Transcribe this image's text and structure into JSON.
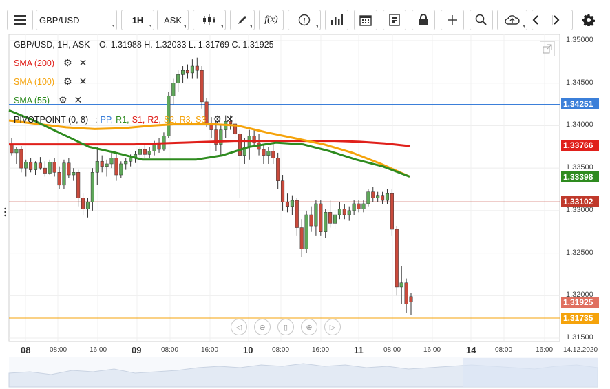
{
  "toolbar": {
    "symbol": "GBP/USD",
    "timeframe": "1H",
    "price_type": "ASK"
  },
  "legend": {
    "symbol_info": "GBP/USD, 1H, ASK",
    "ohlc": "O. 1.31988 H. 1.32033 L. 1.31769 C. 1.31925"
  },
  "indicators": [
    {
      "label": "SMA (200)",
      "color": "#e0201b"
    },
    {
      "label": "SMA (100)",
      "color": "#f5a30b"
    },
    {
      "label": "SMA (55)",
      "color": "#2e8b1f"
    }
  ],
  "pivot": {
    "label": "PIVOTPOINT (0, 8)",
    "separator": ":",
    "parts": [
      {
        "text": "PP,",
        "color": "#3b7fd9"
      },
      {
        "text": "R1,",
        "color": "#2e8b1f"
      },
      {
        "text": "S1,",
        "color": "#e0201b"
      },
      {
        "text": "R2,",
        "color": "#e0201b"
      },
      {
        "text": "S2,",
        "color": "#f5a30b"
      },
      {
        "text": "R3,",
        "color": "#f5a30b"
      },
      {
        "text": "S3",
        "color": "#f5a30b"
      }
    ]
  },
  "price_axis": [
    "1.35000",
    "1.34500",
    "1.34000",
    "1.33500",
    "1.33000",
    "1.32500",
    "1.32000",
    "1.31500"
  ],
  "price_tags": [
    {
      "value": "1.34251",
      "color": "#3b7fd9"
    },
    {
      "value": "1.33766",
      "color": "#e0201b"
    },
    {
      "value": "1.33398",
      "color": "#2e8b1f"
    },
    {
      "value": "1.33102",
      "color": "#c0392b"
    },
    {
      "value": "1.31925",
      "color": "#e07060"
    },
    {
      "value": "1.31735",
      "color": "#f5a30b"
    }
  ],
  "time_axis": [
    {
      "label": "08",
      "day": true
    },
    {
      "label": "08:00",
      "day": false
    },
    {
      "label": "16:00",
      "day": false
    },
    {
      "label": "09",
      "day": true
    },
    {
      "label": "08:00",
      "day": false
    },
    {
      "label": "16:00",
      "day": false
    },
    {
      "label": "10",
      "day": true
    },
    {
      "label": "08:00",
      "day": false
    },
    {
      "label": "16:00",
      "day": false
    },
    {
      "label": "11",
      "day": true
    },
    {
      "label": "08:00",
      "day": false
    },
    {
      "label": "16:00",
      "day": false
    },
    {
      "label": "14",
      "day": true
    },
    {
      "label": "08:00",
      "day": false
    },
    {
      "label": "16:00",
      "day": false
    },
    {
      "label": "14.12.2020",
      "day": false
    }
  ],
  "chart_data": {
    "type": "candlestick",
    "symbol": "GBP/USD",
    "interval": "1H",
    "ylim": [
      1.3135,
      1.351
    ],
    "levels": {
      "pivot_pp": 1.34251,
      "s1": 1.33102,
      "s2": 1.31735,
      "last": 1.31925
    },
    "candles": [
      [
        1.3378,
        1.3385,
        1.3365,
        1.3368
      ],
      [
        1.3368,
        1.3375,
        1.3355,
        1.3372
      ],
      [
        1.3372,
        1.3376,
        1.3345,
        1.335
      ],
      [
        1.335,
        1.336,
        1.334,
        1.3357
      ],
      [
        1.3357,
        1.3362,
        1.3345,
        1.3348
      ],
      [
        1.3348,
        1.3358,
        1.3342,
        1.3356
      ],
      [
        1.3356,
        1.3363,
        1.3348,
        1.335
      ],
      [
        1.335,
        1.3358,
        1.334,
        1.3344
      ],
      [
        1.3344,
        1.336,
        1.3342,
        1.3357
      ],
      [
        1.3357,
        1.3362,
        1.334,
        1.3345
      ],
      [
        1.3345,
        1.3352,
        1.3325,
        1.333
      ],
      [
        1.333,
        1.336,
        1.3325,
        1.3356
      ],
      [
        1.3356,
        1.3362,
        1.3338,
        1.3342
      ],
      [
        1.3342,
        1.335,
        1.3335,
        1.3345
      ],
      [
        1.3345,
        1.3348,
        1.3305,
        1.3315
      ],
      [
        1.3315,
        1.332,
        1.3295,
        1.3302
      ],
      [
        1.3302,
        1.3315,
        1.3292,
        1.331
      ],
      [
        1.331,
        1.335,
        1.33,
        1.3345
      ],
      [
        1.3345,
        1.3375,
        1.333,
        1.3358
      ],
      [
        1.3358,
        1.3365,
        1.3345,
        1.3352
      ],
      [
        1.3352,
        1.336,
        1.334,
        1.3355
      ],
      [
        1.3355,
        1.3368,
        1.335,
        1.3362
      ],
      [
        1.3362,
        1.3368,
        1.3335,
        1.3342
      ],
      [
        1.3342,
        1.3358,
        1.3338,
        1.3355
      ],
      [
        1.3355,
        1.3362,
        1.3348,
        1.3358
      ],
      [
        1.3358,
        1.3366,
        1.3352,
        1.3362
      ],
      [
        1.3362,
        1.337,
        1.3356,
        1.3366
      ],
      [
        1.3366,
        1.3375,
        1.336,
        1.3372
      ],
      [
        1.3372,
        1.3378,
        1.3362,
        1.3366
      ],
      [
        1.3366,
        1.3375,
        1.3362,
        1.337
      ],
      [
        1.337,
        1.3382,
        1.3365,
        1.3378
      ],
      [
        1.3378,
        1.3385,
        1.3368,
        1.3372
      ],
      [
        1.3372,
        1.3392,
        1.337,
        1.3388
      ],
      [
        1.3388,
        1.344,
        1.3385,
        1.3435
      ],
      [
        1.3435,
        1.3455,
        1.3425,
        1.345
      ],
      [
        1.345,
        1.3465,
        1.344,
        1.346
      ],
      [
        1.346,
        1.347,
        1.345,
        1.3465
      ],
      [
        1.3465,
        1.3472,
        1.3455,
        1.3462
      ],
      [
        1.3462,
        1.3478,
        1.3455,
        1.347
      ],
      [
        1.347,
        1.348,
        1.3455,
        1.3465
      ],
      [
        1.3465,
        1.347,
        1.342,
        1.3428
      ],
      [
        1.3428,
        1.3432,
        1.3398,
        1.3403
      ],
      [
        1.3403,
        1.341,
        1.3385,
        1.3395
      ],
      [
        1.3395,
        1.3405,
        1.337,
        1.3378
      ],
      [
        1.3378,
        1.34,
        1.3365,
        1.3395
      ],
      [
        1.3395,
        1.3412,
        1.3385,
        1.3405
      ],
      [
        1.3405,
        1.3412,
        1.3395,
        1.3402
      ],
      [
        1.3402,
        1.341,
        1.3385,
        1.339
      ],
      [
        1.339,
        1.3395,
        1.3315,
        1.3365
      ],
      [
        1.3365,
        1.3385,
        1.3355,
        1.3375
      ],
      [
        1.3375,
        1.3395,
        1.336,
        1.3388
      ],
      [
        1.3388,
        1.3395,
        1.3375,
        1.338
      ],
      [
        1.338,
        1.339,
        1.3365,
        1.3372
      ],
      [
        1.3372,
        1.3378,
        1.3355,
        1.3365
      ],
      [
        1.3365,
        1.3375,
        1.3355,
        1.337
      ],
      [
        1.337,
        1.338,
        1.3355,
        1.3362
      ],
      [
        1.3362,
        1.3368,
        1.3325,
        1.3335
      ],
      [
        1.3335,
        1.3342,
        1.33,
        1.331
      ],
      [
        1.331,
        1.332,
        1.3298,
        1.3305
      ],
      [
        1.3305,
        1.3318,
        1.3295,
        1.3312
      ],
      [
        1.3312,
        1.3315,
        1.327,
        1.328
      ],
      [
        1.328,
        1.329,
        1.3245,
        1.3255
      ],
      [
        1.3255,
        1.33,
        1.325,
        1.3295
      ],
      [
        1.3295,
        1.3305,
        1.3275,
        1.3282
      ],
      [
        1.3282,
        1.3312,
        1.327,
        1.3308
      ],
      [
        1.3308,
        1.3312,
        1.327,
        1.3275
      ],
      [
        1.3275,
        1.3302,
        1.3268,
        1.3298
      ],
      [
        1.3298,
        1.3312,
        1.328,
        1.3285
      ],
      [
        1.3285,
        1.33,
        1.3278,
        1.3295
      ],
      [
        1.3295,
        1.331,
        1.329,
        1.3302
      ],
      [
        1.3302,
        1.3308,
        1.329,
        1.3295
      ],
      [
        1.3295,
        1.3305,
        1.3288,
        1.33
      ],
      [
        1.33,
        1.3312,
        1.3295,
        1.3308
      ],
      [
        1.3308,
        1.3312,
        1.3298,
        1.3302
      ],
      [
        1.3302,
        1.3312,
        1.3298,
        1.3308
      ],
      [
        1.3308,
        1.3325,
        1.3305,
        1.3322
      ],
      [
        1.3322,
        1.3328,
        1.331,
        1.3315
      ],
      [
        1.3315,
        1.3322,
        1.331,
        1.3318
      ],
      [
        1.3318,
        1.3322,
        1.3308,
        1.3312
      ],
      [
        1.3312,
        1.3325,
        1.3308,
        1.332
      ],
      [
        1.332,
        1.3325,
        1.327,
        1.3278
      ],
      [
        1.3278,
        1.3282,
        1.32,
        1.321
      ],
      [
        1.321,
        1.3235,
        1.319,
        1.3215
      ],
      [
        1.3215,
        1.322,
        1.318,
        1.319
      ],
      [
        1.31988,
        1.32033,
        1.31769,
        1.31925
      ]
    ],
    "sma200": [
      1.3378,
      1.3378,
      1.3378,
      1.3378,
      1.3378,
      1.3378,
      1.3379,
      1.338,
      1.3381,
      1.3382,
      1.3382,
      1.3382,
      1.3382,
      1.3382,
      1.3381,
      1.3379,
      1.3376
    ],
    "sma100": [
      1.3406,
      1.3402,
      1.3398,
      1.3396,
      1.3397,
      1.34,
      1.3402,
      1.3402,
      1.34,
      1.3392,
      1.3385,
      1.3378,
      1.3368,
      1.3355,
      1.334
    ],
    "sma55": [
      1.3418,
      1.3405,
      1.339,
      1.3375,
      1.3368,
      1.336,
      1.336,
      1.336,
      1.3365,
      1.3375,
      1.338,
      1.3378,
      1.337,
      1.336,
      1.3352,
      1.334
    ]
  }
}
